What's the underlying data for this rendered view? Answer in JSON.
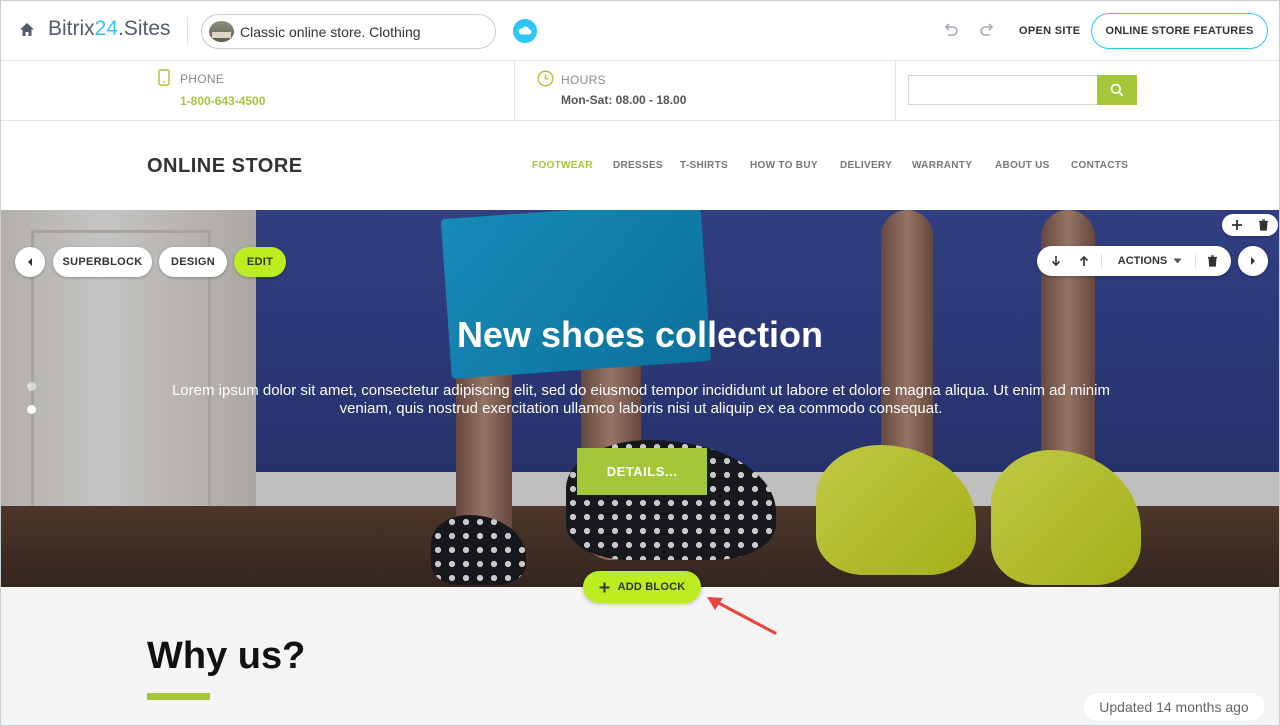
{
  "toolbar": {
    "brand_prefix": "Bitrix",
    "brand_num": "24",
    "brand_suffix": ".Sites",
    "site_name": "Classic online store. Clothing",
    "open_site_label": "OPEN SITE",
    "features_label": "ONLINE STORE FEATURES"
  },
  "contacts": {
    "phone_label": "PHONE",
    "phone_value": "1-800-643-4500",
    "hours_label": "HOURS",
    "hours_value": "Mon-Sat: 08.00 - 18.00",
    "search_placeholder": ""
  },
  "store": {
    "title": "ONLINE STORE",
    "nav": [
      {
        "label": "FOOTWEAR",
        "active": true
      },
      {
        "label": "DRESSES",
        "active": false
      },
      {
        "label": "T-SHIRTS",
        "active": false
      },
      {
        "label": "HOW TO BUY",
        "active": false
      },
      {
        "label": "DELIVERY",
        "active": false
      },
      {
        "label": "WARRANTY",
        "active": false
      },
      {
        "label": "ABOUT US",
        "active": false
      },
      {
        "label": "CONTACTS",
        "active": false
      }
    ]
  },
  "hero": {
    "title": "New shoes collection",
    "text": "Lorem ipsum dolor sit amet, consectetur adipiscing elit, sed do eiusmod tempor incididunt ut labore et dolore magna aliqua. Ut enim ad minim veniam, quis nostrud exercitation ullamco laboris nisi ut aliquip ex ea commodo consequat.",
    "button_label": "DETAILS...",
    "slides": 2,
    "active_slide": 2
  },
  "block_controls": {
    "superblock_label": "SUPERBLOCK",
    "design_label": "DESIGN",
    "edit_label": "EDIT",
    "actions_label": "ACTIONS",
    "add_block_label": "ADD BLOCK"
  },
  "section": {
    "title": "Why us?"
  },
  "status": {
    "updated": "Updated 14 months ago"
  },
  "colors": {
    "accent_green": "#a4c639",
    "editor_lime": "#bbed21",
    "bitrix_blue": "#2fc6f6",
    "annotation_arrow": "#e8453c"
  },
  "icons": [
    "home-icon",
    "cloud-icon",
    "undo-icon",
    "redo-icon",
    "phone-icon",
    "clock-icon",
    "search-icon",
    "chevron-left-icon",
    "chevron-right-icon",
    "arrow-down-icon",
    "arrow-up-icon",
    "caret-down-icon",
    "trash-icon",
    "plus-icon"
  ]
}
